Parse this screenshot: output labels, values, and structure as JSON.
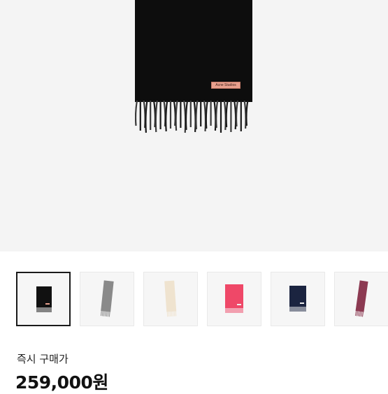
{
  "product": {
    "brand_tag": "Acne Studios",
    "main_image_icon": "black-scarf-image"
  },
  "thumbnails": [
    {
      "color_name": "black",
      "scarf_color": "#111111",
      "selected": true
    },
    {
      "color_name": "grey",
      "scarf_color": "#8a8a8a",
      "selected": false
    },
    {
      "color_name": "cream",
      "scarf_color": "#efe3cf",
      "selected": false
    },
    {
      "color_name": "pink",
      "scarf_color": "#ef4868",
      "selected": false
    },
    {
      "color_name": "navy",
      "scarf_color": "#1b2440",
      "selected": false
    },
    {
      "color_name": "burgundy",
      "scarf_color": "#8c3a52",
      "selected": false
    }
  ],
  "purchase": {
    "label": "즉시 구매가",
    "price": "259,000원"
  }
}
